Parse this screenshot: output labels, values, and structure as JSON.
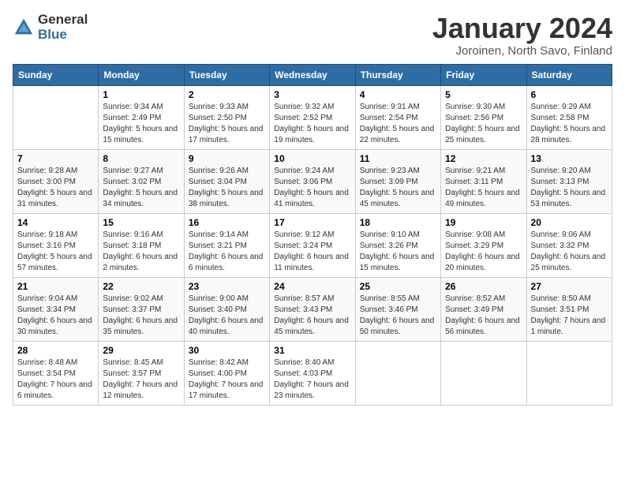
{
  "header": {
    "logo_general": "General",
    "logo_blue": "Blue",
    "month_title": "January 2024",
    "subtitle": "Joroinen, North Savo, Finland"
  },
  "days_of_week": [
    "Sunday",
    "Monday",
    "Tuesday",
    "Wednesday",
    "Thursday",
    "Friday",
    "Saturday"
  ],
  "weeks": [
    [
      {
        "day": "",
        "sunrise": "",
        "sunset": "",
        "daylight": ""
      },
      {
        "day": "1",
        "sunrise": "Sunrise: 9:34 AM",
        "sunset": "Sunset: 2:49 PM",
        "daylight": "Daylight: 5 hours and 15 minutes."
      },
      {
        "day": "2",
        "sunrise": "Sunrise: 9:33 AM",
        "sunset": "Sunset: 2:50 PM",
        "daylight": "Daylight: 5 hours and 17 minutes."
      },
      {
        "day": "3",
        "sunrise": "Sunrise: 9:32 AM",
        "sunset": "Sunset: 2:52 PM",
        "daylight": "Daylight: 5 hours and 19 minutes."
      },
      {
        "day": "4",
        "sunrise": "Sunrise: 9:31 AM",
        "sunset": "Sunset: 2:54 PM",
        "daylight": "Daylight: 5 hours and 22 minutes."
      },
      {
        "day": "5",
        "sunrise": "Sunrise: 9:30 AM",
        "sunset": "Sunset: 2:56 PM",
        "daylight": "Daylight: 5 hours and 25 minutes."
      },
      {
        "day": "6",
        "sunrise": "Sunrise: 9:29 AM",
        "sunset": "Sunset: 2:58 PM",
        "daylight": "Daylight: 5 hours and 28 minutes."
      }
    ],
    [
      {
        "day": "7",
        "sunrise": "Sunrise: 9:28 AM",
        "sunset": "Sunset: 3:00 PM",
        "daylight": "Daylight: 5 hours and 31 minutes."
      },
      {
        "day": "8",
        "sunrise": "Sunrise: 9:27 AM",
        "sunset": "Sunset: 3:02 PM",
        "daylight": "Daylight: 5 hours and 34 minutes."
      },
      {
        "day": "9",
        "sunrise": "Sunrise: 9:26 AM",
        "sunset": "Sunset: 3:04 PM",
        "daylight": "Daylight: 5 hours and 38 minutes."
      },
      {
        "day": "10",
        "sunrise": "Sunrise: 9:24 AM",
        "sunset": "Sunset: 3:06 PM",
        "daylight": "Daylight: 5 hours and 41 minutes."
      },
      {
        "day": "11",
        "sunrise": "Sunrise: 9:23 AM",
        "sunset": "Sunset: 3:09 PM",
        "daylight": "Daylight: 5 hours and 45 minutes."
      },
      {
        "day": "12",
        "sunrise": "Sunrise: 9:21 AM",
        "sunset": "Sunset: 3:11 PM",
        "daylight": "Daylight: 5 hours and 49 minutes."
      },
      {
        "day": "13",
        "sunrise": "Sunrise: 9:20 AM",
        "sunset": "Sunset: 3:13 PM",
        "daylight": "Daylight: 5 hours and 53 minutes."
      }
    ],
    [
      {
        "day": "14",
        "sunrise": "Sunrise: 9:18 AM",
        "sunset": "Sunset: 3:16 PM",
        "daylight": "Daylight: 5 hours and 57 minutes."
      },
      {
        "day": "15",
        "sunrise": "Sunrise: 9:16 AM",
        "sunset": "Sunset: 3:18 PM",
        "daylight": "Daylight: 6 hours and 2 minutes."
      },
      {
        "day": "16",
        "sunrise": "Sunrise: 9:14 AM",
        "sunset": "Sunset: 3:21 PM",
        "daylight": "Daylight: 6 hours and 6 minutes."
      },
      {
        "day": "17",
        "sunrise": "Sunrise: 9:12 AM",
        "sunset": "Sunset: 3:24 PM",
        "daylight": "Daylight: 6 hours and 11 minutes."
      },
      {
        "day": "18",
        "sunrise": "Sunrise: 9:10 AM",
        "sunset": "Sunset: 3:26 PM",
        "daylight": "Daylight: 6 hours and 15 minutes."
      },
      {
        "day": "19",
        "sunrise": "Sunrise: 9:08 AM",
        "sunset": "Sunset: 3:29 PM",
        "daylight": "Daylight: 6 hours and 20 minutes."
      },
      {
        "day": "20",
        "sunrise": "Sunrise: 9:06 AM",
        "sunset": "Sunset: 3:32 PM",
        "daylight": "Daylight: 6 hours and 25 minutes."
      }
    ],
    [
      {
        "day": "21",
        "sunrise": "Sunrise: 9:04 AM",
        "sunset": "Sunset: 3:34 PM",
        "daylight": "Daylight: 6 hours and 30 minutes."
      },
      {
        "day": "22",
        "sunrise": "Sunrise: 9:02 AM",
        "sunset": "Sunset: 3:37 PM",
        "daylight": "Daylight: 6 hours and 35 minutes."
      },
      {
        "day": "23",
        "sunrise": "Sunrise: 9:00 AM",
        "sunset": "Sunset: 3:40 PM",
        "daylight": "Daylight: 6 hours and 40 minutes."
      },
      {
        "day": "24",
        "sunrise": "Sunrise: 8:57 AM",
        "sunset": "Sunset: 3:43 PM",
        "daylight": "Daylight: 6 hours and 45 minutes."
      },
      {
        "day": "25",
        "sunrise": "Sunrise: 8:55 AM",
        "sunset": "Sunset: 3:46 PM",
        "daylight": "Daylight: 6 hours and 50 minutes."
      },
      {
        "day": "26",
        "sunrise": "Sunrise: 8:52 AM",
        "sunset": "Sunset: 3:49 PM",
        "daylight": "Daylight: 6 hours and 56 minutes."
      },
      {
        "day": "27",
        "sunrise": "Sunrise: 8:50 AM",
        "sunset": "Sunset: 3:51 PM",
        "daylight": "Daylight: 7 hours and 1 minute."
      }
    ],
    [
      {
        "day": "28",
        "sunrise": "Sunrise: 8:48 AM",
        "sunset": "Sunset: 3:54 PM",
        "daylight": "Daylight: 7 hours and 6 minutes."
      },
      {
        "day": "29",
        "sunrise": "Sunrise: 8:45 AM",
        "sunset": "Sunset: 3:57 PM",
        "daylight": "Daylight: 7 hours and 12 minutes."
      },
      {
        "day": "30",
        "sunrise": "Sunrise: 8:42 AM",
        "sunset": "Sunset: 4:00 PM",
        "daylight": "Daylight: 7 hours and 17 minutes."
      },
      {
        "day": "31",
        "sunrise": "Sunrise: 8:40 AM",
        "sunset": "Sunset: 4:03 PM",
        "daylight": "Daylight: 7 hours and 23 minutes."
      },
      {
        "day": "",
        "sunrise": "",
        "sunset": "",
        "daylight": ""
      },
      {
        "day": "",
        "sunrise": "",
        "sunset": "",
        "daylight": ""
      },
      {
        "day": "",
        "sunrise": "",
        "sunset": "",
        "daylight": ""
      }
    ]
  ]
}
